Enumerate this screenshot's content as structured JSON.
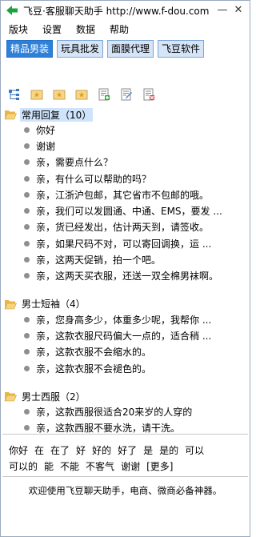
{
  "window": {
    "title": "飞豆·客服聊天助手 http://www.f-dou.com",
    "minimize_label": "—",
    "close_label": "✕"
  },
  "menu": [
    "版块",
    "设置",
    "数据",
    "帮助"
  ],
  "categories": [
    {
      "label": "精品男装",
      "active": true
    },
    {
      "label": "玩具批发",
      "active": false
    },
    {
      "label": "面膜代理",
      "active": false
    },
    {
      "label": "飞豆软件",
      "active": false
    }
  ],
  "toolbar": {
    "icons": [
      "tree-structure-icon",
      "add-folder-icon",
      "edit-folder-icon",
      "delete-folder-icon",
      "add-item-icon",
      "edit-item-icon",
      "delete-item-icon"
    ]
  },
  "groups": [
    {
      "label": "常用回复（10）",
      "items": [
        "你好",
        "谢谢",
        "亲，需要点什么？",
        "亲，有什么可以帮助的吗？",
        "亲，江浙沪包邮，其它省市不包邮的哦。",
        "亲，我们可以发圆通、中通、EMS，要发 ...",
        "亲，货已经发出，估计两天到，请签收。",
        "亲，如果尺码不对，可以寄回调换，运 ...",
        "亲，这两天促销，拍一个吧。",
        "亲，这两天买衣服，还送一双全棉男袜啊。"
      ]
    },
    {
      "label": "男士短袖（4）",
      "items": [
        "亲，您身高多少，体重多少呢，我帮你 ...",
        "亲，这款衣服尺码偏大一点的，适合稍 ...",
        "亲，这款衣服不会缩水的。",
        "亲，这款衣服不会褪色的。"
      ]
    },
    {
      "label": "男士西服（2）",
      "items": [
        "亲，这款西服很适合20来岁的人穿的",
        "亲，这款西服不要水洗，请干洗。"
      ]
    }
  ],
  "quick_phrases": [
    "你好",
    "在",
    "在了",
    "好",
    "好的",
    "好了",
    "是",
    "是的",
    "可以",
    "可以的",
    "能",
    "不能",
    "不客气",
    "谢谢",
    "[更多]"
  ],
  "status_text": "欢迎使用飞豆聊天助手，电商、微商必备神器。",
  "colors": {
    "active_tab": "#2f80d8",
    "tab": "#d5e4f6",
    "selected_group": "#cfe3fb",
    "app_icon": "#1aa33a"
  }
}
